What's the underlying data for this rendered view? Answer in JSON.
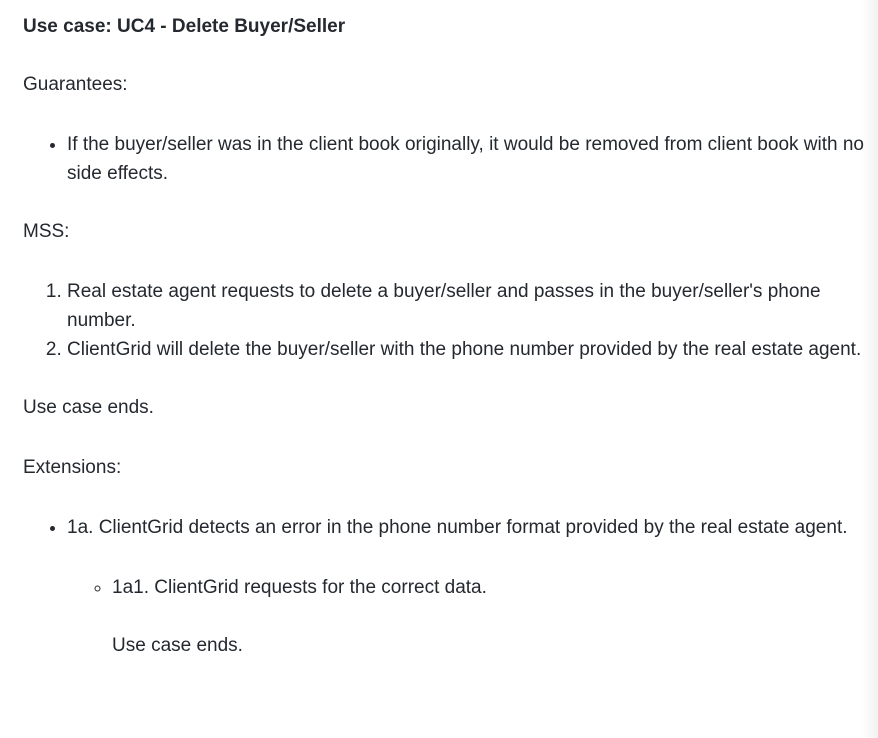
{
  "title": "Use case: UC4 - Delete Buyer/Seller",
  "guarantees": {
    "label": "Guarantees:",
    "items": [
      "If the buyer/seller was in the client book originally, it would be removed from client book with no side effects."
    ]
  },
  "mss": {
    "label": "MSS:",
    "steps": [
      "Real estate agent requests to delete a buyer/seller and passes in the buyer/seller's phone number.",
      "ClientGrid will delete the buyer/seller with the phone number provided by the real estate agent."
    ]
  },
  "use_case_ends": "Use case ends.",
  "extensions": {
    "label": "Extensions:",
    "items": [
      {
        "text": "1a. ClientGrid detects an error in the phone number format provided by the real estate agent.",
        "sub_items": [
          {
            "text": "1a1. ClientGrid requests for the correct data.",
            "note": "Use case ends."
          }
        ]
      }
    ]
  }
}
